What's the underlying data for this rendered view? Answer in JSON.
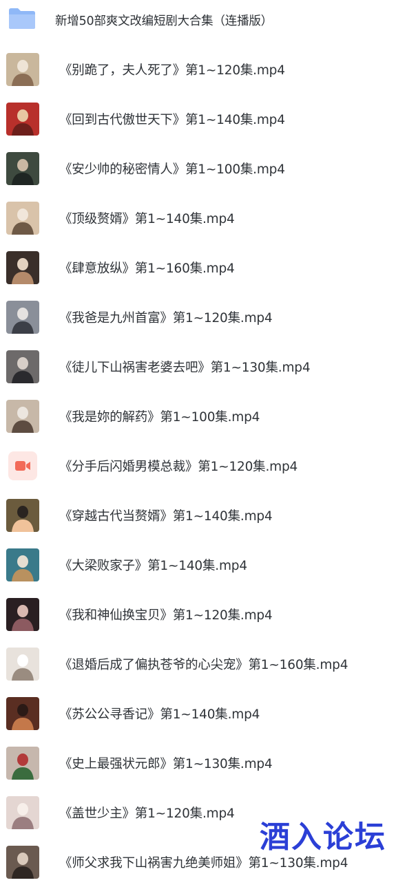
{
  "folder": {
    "name": "新增50部爽文改编短剧大合集（连播版）",
    "icon": "folder-icon"
  },
  "files": [
    {
      "name": "《别跪了，夫人死了》第1~120集.mp4",
      "thumb": "video-thumbnail"
    },
    {
      "name": "《回到古代傲世天下》第1~140集.mp4",
      "thumb": "video-thumbnail"
    },
    {
      "name": "《安少帅的秘密情人》第1~100集.mp4",
      "thumb": "video-thumbnail"
    },
    {
      "name": "《顶级赘婿》第1~140集.mp4",
      "thumb": "video-thumbnail"
    },
    {
      "name": "《肆意放纵》第1~160集.mp4",
      "thumb": "video-thumbnail"
    },
    {
      "name": "《我爸是九州首富》第1~120集.mp4",
      "thumb": "video-thumbnail"
    },
    {
      "name": "《徒儿下山祸害老婆去吧》第1~130集.mp4",
      "thumb": "video-thumbnail"
    },
    {
      "name": "《我是妳的解药》第1~100集.mp4",
      "thumb": "video-thumbnail"
    },
    {
      "name": "《分手后闪婚男模总裁》第1~120集.mp4",
      "thumb": "video-file-icon"
    },
    {
      "name": "《穿越古代当赘婿》第1~140集.mp4",
      "thumb": "video-thumbnail"
    },
    {
      "name": "《大梁败家子》第1~140集.mp4",
      "thumb": "video-thumbnail"
    },
    {
      "name": "《我和神仙换宝贝》第1~120集.mp4",
      "thumb": "video-thumbnail"
    },
    {
      "name": "《退婚后成了偏执苍爷的心尖宠》第1~160集.mp4",
      "thumb": "video-thumbnail"
    },
    {
      "name": "《苏公公寻香记》第1~140集.mp4",
      "thumb": "video-thumbnail"
    },
    {
      "name": "《史上最强状元郎》第1~130集.mp4",
      "thumb": "video-thumbnail"
    },
    {
      "name": "《盖世少主》第1~120集.mp4",
      "thumb": "video-thumbnail"
    },
    {
      "name": "《师父求我下山祸害九绝美师姐》第1~130集.mp4",
      "thumb": "video-thumbnail"
    }
  ],
  "watermark": "酒入论坛",
  "colors": {
    "text": "#2f3338",
    "folder": "#8fb8f7",
    "video_icon_bg": "#fde7e4",
    "video_icon": "#f26a58",
    "watermark": "#2b3fd6"
  }
}
